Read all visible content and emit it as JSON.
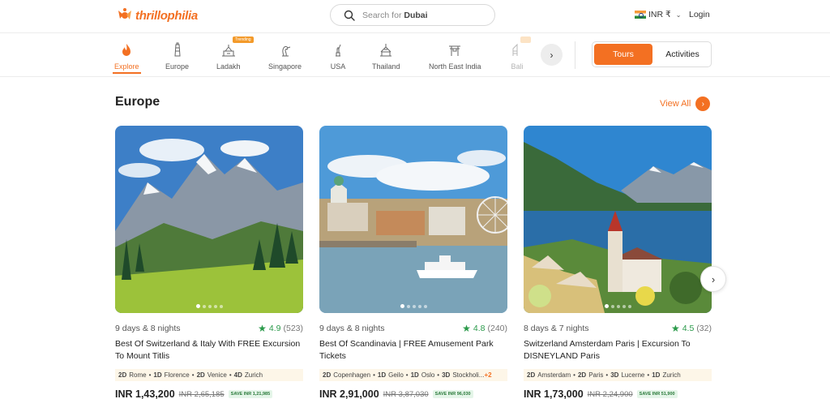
{
  "header": {
    "logo_text": "thrillophilia",
    "search_prefix": "Search for",
    "search_term": "Dubai",
    "currency": "INR ₹",
    "login": "Login"
  },
  "categories": [
    {
      "label": "Explore",
      "icon": "flame-icon"
    },
    {
      "label": "Europe",
      "icon": "tower-icon"
    },
    {
      "label": "Ladakh",
      "icon": "monastery-icon",
      "badge": "Trending"
    },
    {
      "label": "Singapore",
      "icon": "merlion-icon"
    },
    {
      "label": "USA",
      "icon": "statue-of-liberty-icon"
    },
    {
      "label": "Thailand",
      "icon": "temple-icon"
    },
    {
      "label": "North East India",
      "icon": "gate-icon"
    },
    {
      "label": "Bali",
      "icon": "bali-temple-icon"
    }
  ],
  "toggle": {
    "tours": "Tours",
    "activities": "Activities"
  },
  "section": {
    "title": "Europe",
    "view_all": "View All"
  },
  "cards": [
    {
      "duration": "9 days & 8 nights",
      "rating": "4.9",
      "reviews": "(523)",
      "title": "Best Of Switzerland & Italy With FREE Excursion To Mount Titlis",
      "itinerary": [
        {
          "days": "2D",
          "place": "Rome"
        },
        {
          "days": "1D",
          "place": "Florence"
        },
        {
          "days": "2D",
          "place": "Venice"
        },
        {
          "days": "4D",
          "place": "Zurich"
        }
      ],
      "itinerary_more": "",
      "price": "INR 1,43,200",
      "old_price": "INR 2,65,185",
      "save": "SAVE INR 1,21,985"
    },
    {
      "duration": "9 days & 8 nights",
      "rating": "4.8",
      "reviews": "(240)",
      "title": "Best Of Scandinavia | FREE Amusement Park Tickets",
      "itinerary": [
        {
          "days": "2D",
          "place": "Copenhagen"
        },
        {
          "days": "1D",
          "place": "Geilo"
        },
        {
          "days": "1D",
          "place": "Oslo"
        },
        {
          "days": "3D",
          "place": "Stockholi..."
        }
      ],
      "itinerary_more": "+2",
      "price": "INR 2,91,000",
      "old_price": "INR 3,87,030",
      "save": "SAVE INR 96,030"
    },
    {
      "duration": "8 days & 7 nights",
      "rating": "4.5",
      "reviews": "(32)",
      "title": "Switzerland Amsterdam Paris | Excursion To DISNEYLAND Paris",
      "itinerary": [
        {
          "days": "2D",
          "place": "Amsterdam"
        },
        {
          "days": "2D",
          "place": "Paris"
        },
        {
          "days": "3D",
          "place": "Lucerne"
        },
        {
          "days": "1D",
          "place": "Zurich"
        }
      ],
      "itinerary_more": "",
      "price": "INR 1,73,000",
      "old_price": "INR 2,24,900",
      "save": "SAVE INR 51,900"
    }
  ],
  "colors": {
    "accent": "#f37022",
    "rating": "#2a9a4a"
  }
}
